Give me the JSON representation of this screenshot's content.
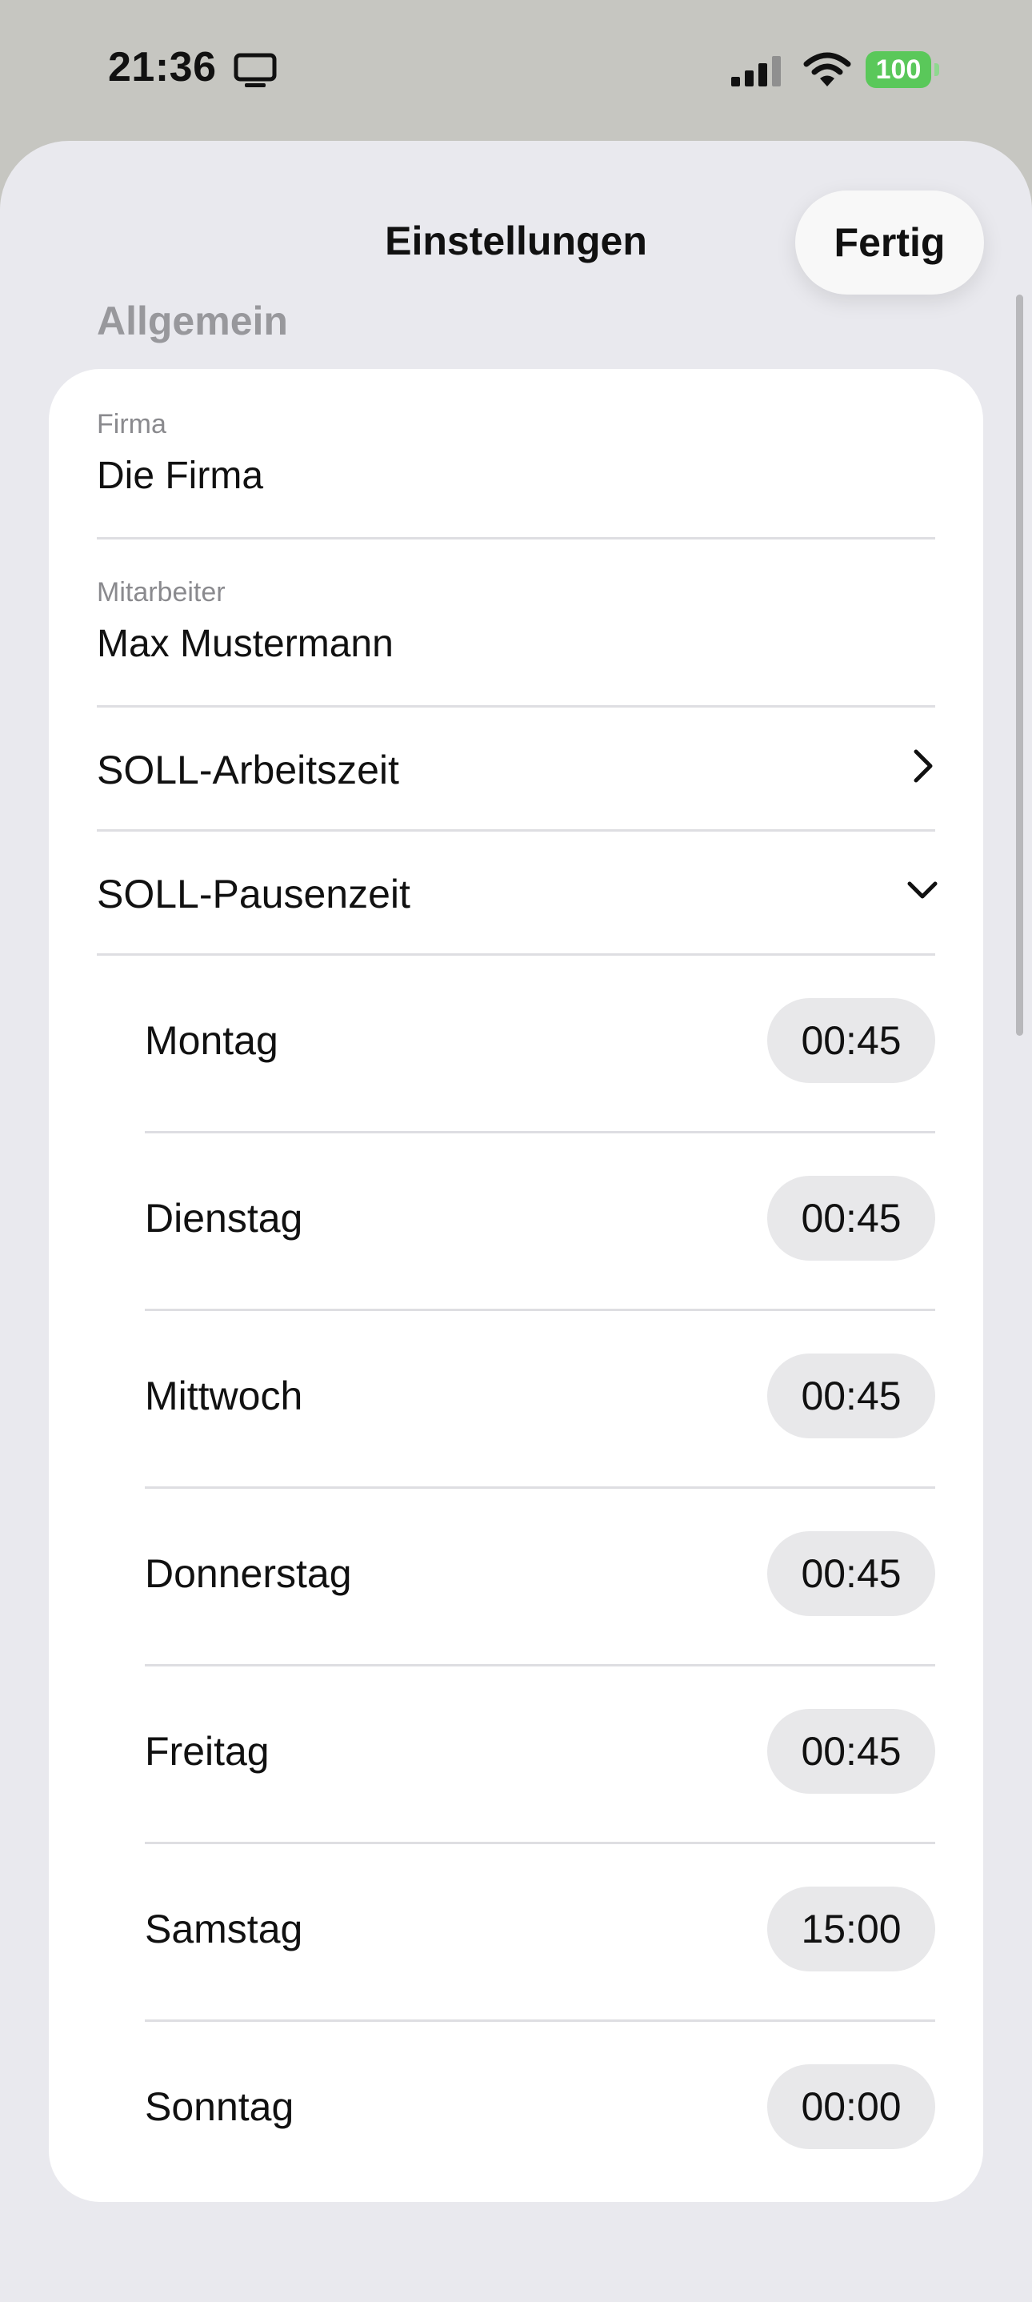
{
  "status_bar": {
    "time": "21:36",
    "battery": "100",
    "icons": [
      "screen-mirroring-icon",
      "cellular-signal-icon",
      "wifi-icon",
      "battery-icon"
    ]
  },
  "nav": {
    "title": "Einstellungen",
    "done_label": "Fertig"
  },
  "section": {
    "header": "Allgemein"
  },
  "fields": {
    "company": {
      "caption": "Firma",
      "value": "Die Firma"
    },
    "employee": {
      "caption": "Mitarbeiter",
      "value": "Max Mustermann"
    }
  },
  "rows": {
    "work_time": {
      "label": "SOLL-Arbeitszeit",
      "icon": "chevron-right-icon"
    },
    "break_time": {
      "label": "SOLL-Pausenzeit",
      "icon": "chevron-down-icon"
    }
  },
  "days": [
    {
      "label": "Montag",
      "time": "00:45"
    },
    {
      "label": "Dienstag",
      "time": "00:45"
    },
    {
      "label": "Mittwoch",
      "time": "00:45"
    },
    {
      "label": "Donnerstag",
      "time": "00:45"
    },
    {
      "label": "Freitag",
      "time": "00:45"
    },
    {
      "label": "Samstag",
      "time": "15:00"
    },
    {
      "label": "Sonntag",
      "time": "00:00"
    }
  ],
  "colors": {
    "status_background": "#c6c6c1",
    "sheet_background": "#e9e9ee",
    "card_background": "#ffffff",
    "pill_background": "#e8e8ea",
    "battery": "#5ac85a",
    "secondary_text": "#8a8a8e"
  }
}
